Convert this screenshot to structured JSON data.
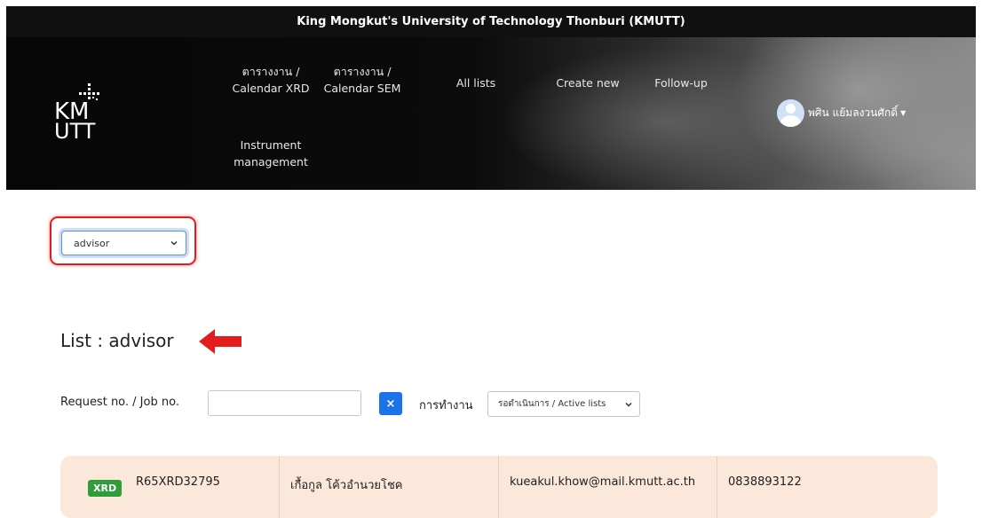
{
  "header": {
    "university": "King Mongkut's University of Technology Thonburi (KMUTT)",
    "logo_text": "KMUTT"
  },
  "nav": [
    {
      "label_line1": "ตารางงาน /",
      "label_line2": "Calendar XRD"
    },
    {
      "label_line1": "ตารางงาน /",
      "label_line2": "Calendar SEM"
    },
    {
      "label_line1": "All lists"
    },
    {
      "label_line1": "Create new"
    },
    {
      "label_line1": "Follow-up"
    },
    {
      "label_line1": "Instrument",
      "label_line2": "management"
    }
  ],
  "user": {
    "name": "พศิน แย้มลงวนศักดิ์"
  },
  "role_select": {
    "value": "advisor"
  },
  "list_title": "List : advisor",
  "filters": {
    "request_label": "Request no. / Job no.",
    "request_value": "",
    "clear_icon": "×",
    "work_label": "การทำงาน",
    "status_value": "รอดำเนินการ / Active lists"
  },
  "rows": [
    {
      "badge": "XRD",
      "request_no": "R65XRD32795",
      "name": "เกื้อกูล โค้วอำนวยโชค",
      "email": "kueakul.khow@mail.kmutt.ac.th",
      "phone": "0838893122"
    }
  ],
  "colors": {
    "accent": "#1a73e8",
    "highlight": "#e51c1c",
    "badge": "#2e9e3d",
    "card_bg": "#fbe8da"
  }
}
